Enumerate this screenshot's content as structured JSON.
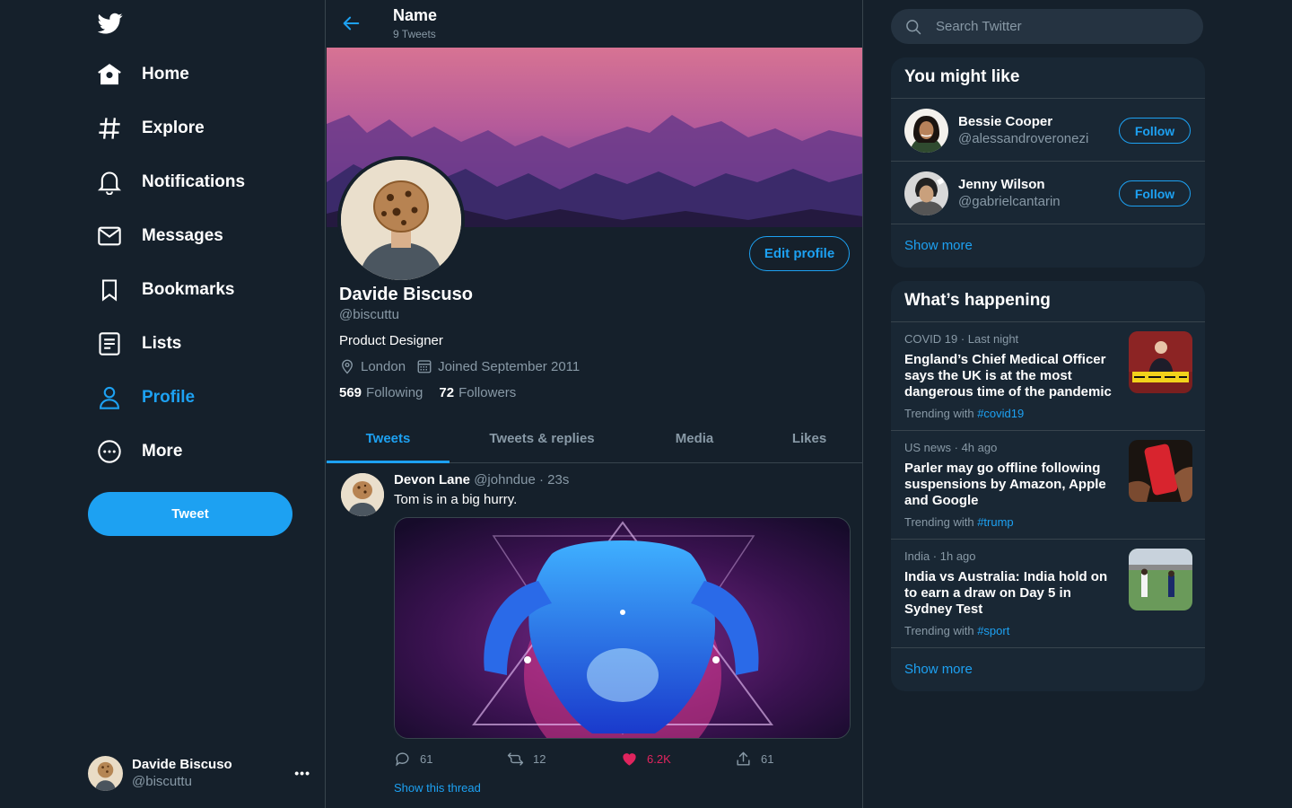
{
  "nav": {
    "items": [
      {
        "label": "Home",
        "icon": "home-icon"
      },
      {
        "label": "Explore",
        "icon": "hashtag-icon"
      },
      {
        "label": "Notifications",
        "icon": "bell-icon"
      },
      {
        "label": "Messages",
        "icon": "envelope-icon"
      },
      {
        "label": "Bookmarks",
        "icon": "bookmark-icon"
      },
      {
        "label": "Lists",
        "icon": "list-icon"
      },
      {
        "label": "Profile",
        "icon": "user-icon",
        "active": true
      },
      {
        "label": "More",
        "icon": "more-circle-icon"
      }
    ],
    "tweet_button": "Tweet"
  },
  "account": {
    "name": "Davide Biscuso",
    "handle": "@biscuttu",
    "menu": "•••"
  },
  "header": {
    "title": "Name",
    "subtitle": "9 Tweets"
  },
  "profile": {
    "name": "Davide Biscuso",
    "handle": "@biscuttu",
    "bio": "Product Designer",
    "location": "London",
    "joined": "Joined September 2011",
    "following_count": "569",
    "following_label": "Following",
    "followers_count": "72",
    "followers_label": "Followers",
    "edit_button": "Edit profile"
  },
  "tabs": [
    {
      "label": "Tweets",
      "active": true
    },
    {
      "label": "Tweets & replies"
    },
    {
      "label": "Media"
    },
    {
      "label": "Likes"
    }
  ],
  "tweet": {
    "author": "Devon Lane",
    "handle": "@johndue",
    "time": "· 23s",
    "text": "Tom is in a big hurry.",
    "replies": "61",
    "retweets": "12",
    "likes": "6.2K",
    "shares": "61",
    "show_thread": "Show this thread"
  },
  "search": {
    "placeholder": "Search Twitter"
  },
  "who_to_follow": {
    "title": "You might like",
    "users": [
      {
        "name": "Bessie Cooper",
        "handle": "@alessandroveronezi",
        "button": "Follow"
      },
      {
        "name": "Jenny Wilson",
        "handle": "@gabrielcantarin",
        "button": "Follow"
      }
    ],
    "show_more": "Show more"
  },
  "trends": {
    "title": "What’s happening",
    "items": [
      {
        "meta": "COVID 19 · Last night",
        "headline": "England’s Chief Medical Officer says the UK is at the most dangerous time of the pandemic",
        "trending_prefix": "Trending with",
        "hashtag": "#covid19"
      },
      {
        "meta": "US news · 4h ago",
        "headline": "Parler may go offline following suspensions by Amazon, Apple and Google",
        "trending_prefix": "Trending with",
        "hashtag": "#trump"
      },
      {
        "meta": "India · 1h ago",
        "headline": "India vs Australia: India hold on to earn a draw on Day 5 in Sydney Test",
        "trending_prefix": "Trending with",
        "hashtag": "#sport"
      }
    ],
    "show_more": "Show more"
  },
  "colors": {
    "background": "#15202b",
    "panel": "#192734",
    "accent": "#1da1f2",
    "like": "#e0245e",
    "muted": "#8899a6",
    "border": "#38444d"
  }
}
